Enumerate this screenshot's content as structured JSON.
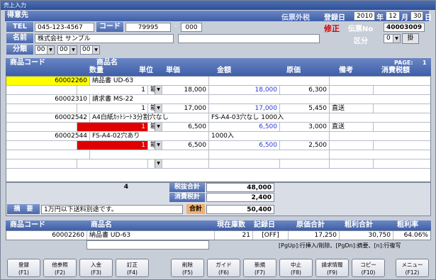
{
  "window_title": "売上入力",
  "header": {
    "customer_label": "得意先",
    "tax_mode": "伝票外税",
    "reg_date_label": "登録日",
    "year": "2010",
    "year_unit": "年",
    "month": "12",
    "month_unit": "月",
    "day": "30",
    "day_unit": "日",
    "tel_label": "TEL",
    "tel_value": "045-123-4567",
    "code_label": "コード",
    "code_value": "79995",
    "code_dash": "-",
    "code_sub": "000",
    "mode_label": "修正",
    "slip_no_label": "伝票No",
    "slip_no_value": "40003009",
    "name_label": "名前",
    "name_value": "株式会社 サンプル",
    "category_label": "分類",
    "cat1": "00",
    "cat2": "00",
    "cat3": "00",
    "division_label": "区分",
    "division_value": "0",
    "division_button": "掛"
  },
  "grid": {
    "col1": "商品コード",
    "col2": "商品名",
    "col3": "PAGE:",
    "page": "1",
    "sub_qty": "数量",
    "sub_unit": "単位",
    "sub_price": "単価",
    "sub_amount": "金額",
    "sub_cost": "原価",
    "sub_note": "備考",
    "sub_tax": "消費税額",
    "rows": [
      {
        "code": "60002260",
        "name": "納品書 UD-63",
        "qty": "1",
        "unit": "箱",
        "price": "18,000",
        "amount": "18,000",
        "cost": "6,300",
        "note": ""
      },
      {
        "code": "60002310",
        "name": "請求書 MS-22",
        "qty": "1",
        "unit": "箱",
        "price": "17,000",
        "amount": "17,000",
        "cost": "5,450",
        "note": "直送"
      },
      {
        "code": "60002542",
        "name": "A4白紙ｶｯﾄｼｰﾄ3分割穴なし",
        "extra": "FS-A4-03穴なし 1000入",
        "qty": "1",
        "unit": "箱",
        "price": "6,500",
        "amount": "6,500",
        "cost": "3,000",
        "note": "直送"
      },
      {
        "code": "60002544",
        "name": "FS-A4-02穴あり",
        "extra": "1000入",
        "qty": "1",
        "unit": "箱",
        "price": "6,500",
        "amount": "6,500",
        "cost": "2,500",
        "note": ""
      }
    ]
  },
  "totals": {
    "count": "4",
    "pretax_label": "税抜合計",
    "pretax_value": "48,000",
    "tax_label": "消費税計",
    "tax_value": "2,400",
    "total_label": "合計",
    "total_value": "50,400",
    "memo_label": "摘　要",
    "memo_value": "1万円以下送料別途です。"
  },
  "detail": {
    "h_code": "商品コード",
    "h_name": "商品名",
    "h_stock": "現在庫数",
    "h_record": "記録日",
    "h_costsum": "原価合計",
    "h_profit": "粗利合計",
    "h_rate": "粗利率",
    "code": "60002260",
    "name": "納品書 UD-63",
    "stock": "21",
    "record": "[OFF]",
    "costsum": "17,250",
    "profit": "30,750",
    "rate": "64.06%"
  },
  "hint": "[PgUp]:行挿入/削除、[PgDn]:摘要、[n]:行複写",
  "buttons": [
    {
      "label": "登録",
      "key": "(F1)"
    },
    {
      "label": "他参照",
      "key": "(F2)"
    },
    {
      "label": "入金",
      "key": "(F3)"
    },
    {
      "label": "訂正",
      "key": "(F4)"
    },
    {
      "label": "削除",
      "key": "(F5)"
    },
    {
      "label": "ガイド",
      "key": "(F6)"
    },
    {
      "label": "新規",
      "key": "(F7)"
    },
    {
      "label": "中止",
      "key": "(F8)"
    },
    {
      "label": "請求情報",
      "key": "(F9)"
    },
    {
      "label": "コピー",
      "key": "(F10)"
    },
    {
      "label": "メニュー",
      "key": "(F12)"
    }
  ]
}
